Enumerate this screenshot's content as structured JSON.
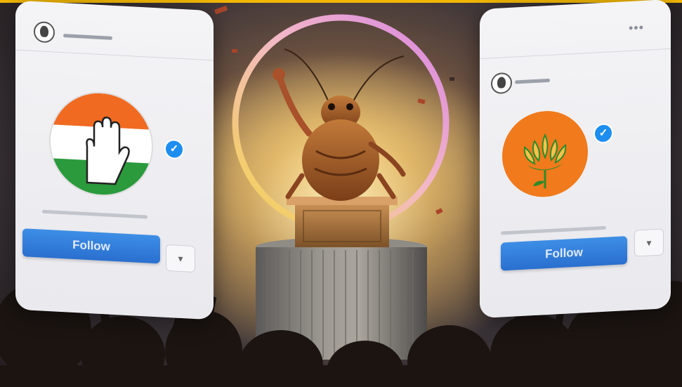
{
  "left_profile": {
    "party_symbol": "hand-symbol-tricolor-logo",
    "follow_label": "Follow",
    "colors": {
      "saffron": "#f06a21",
      "green": "#2a9a3c",
      "white": "#ffffff"
    }
  },
  "right_profile": {
    "party_symbol": "lotus-symbol-logo",
    "follow_label": "Follow",
    "colors": {
      "badge": "#f07a1c",
      "lotus": "#2e8a2a"
    }
  },
  "scene": {
    "subject": "cockroach-at-podium",
    "ring_colors": [
      "#f4d64a",
      "#e08ad8"
    ],
    "accent": "#f2b705"
  }
}
